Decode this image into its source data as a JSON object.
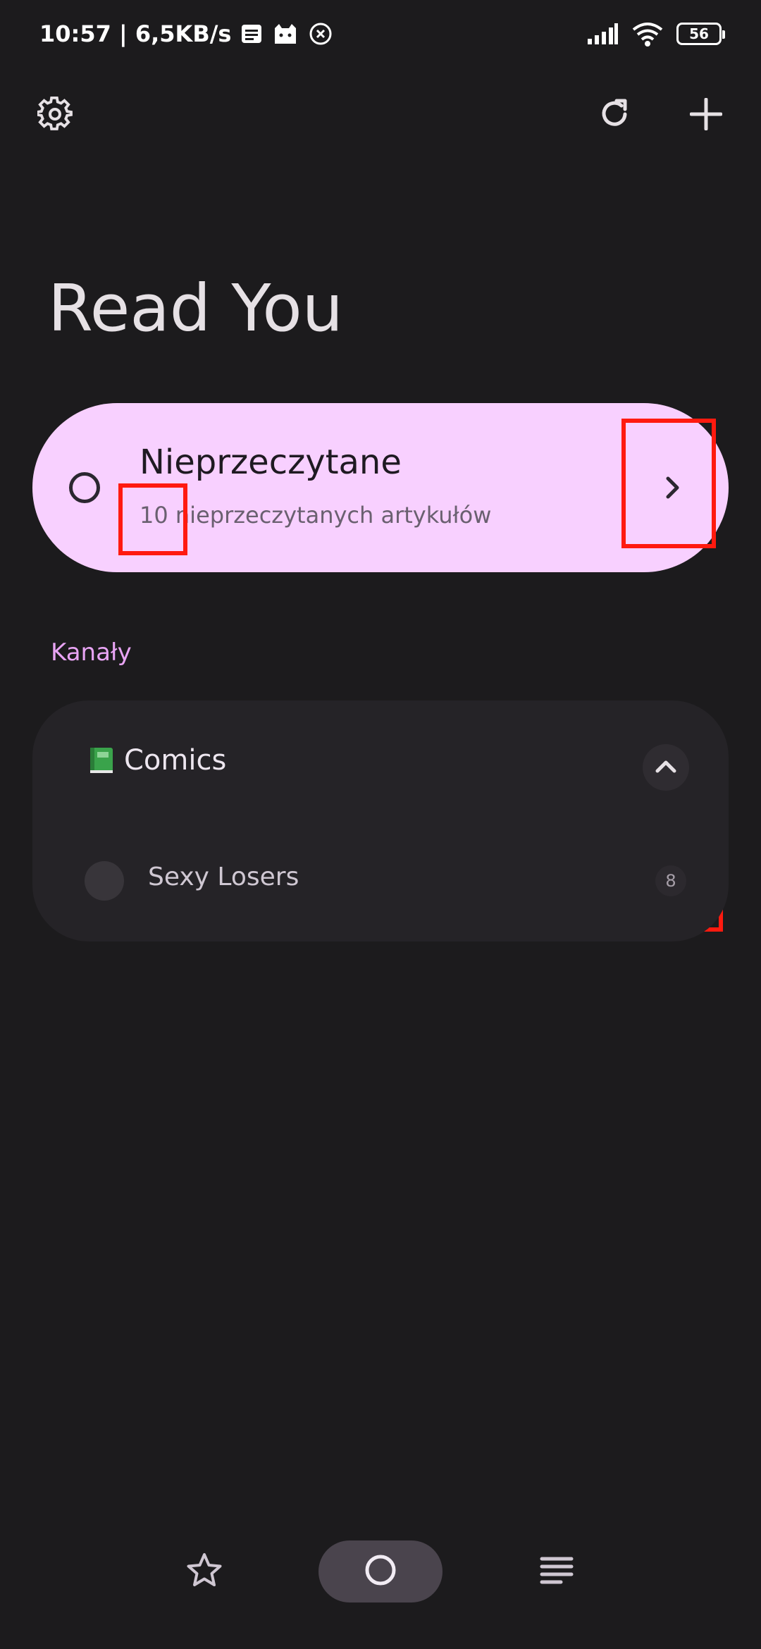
{
  "status_bar": {
    "time_speed": "10:57 | 6,5KB/s",
    "battery": "56",
    "icons": [
      "notes-icon",
      "cat-icon",
      "x-circle-icon",
      "signal-icon",
      "wifi-icon",
      "battery-icon"
    ]
  },
  "top_bar": {
    "icons": [
      "gear-icon",
      "refresh-icon",
      "plus-icon"
    ]
  },
  "app_title": "Read You",
  "unread_card": {
    "title": "Nieprzeczytane",
    "subtitle": "10 nieprzeczytanych artykułów",
    "background": "#f8d0ff"
  },
  "section_label": "Kanały",
  "group": {
    "name": "Comics",
    "icon": "green-book-icon",
    "feeds": [
      {
        "name": "Sexy Losers",
        "count": "8"
      }
    ]
  },
  "bottom_nav": {
    "icons": [
      "star-icon",
      "circle-icon",
      "list-icon"
    ],
    "active": "circle-icon"
  },
  "colors": {
    "background": "#1c1b1d",
    "accent": "#e8a4f4",
    "highlight": "#ff1a0f"
  }
}
